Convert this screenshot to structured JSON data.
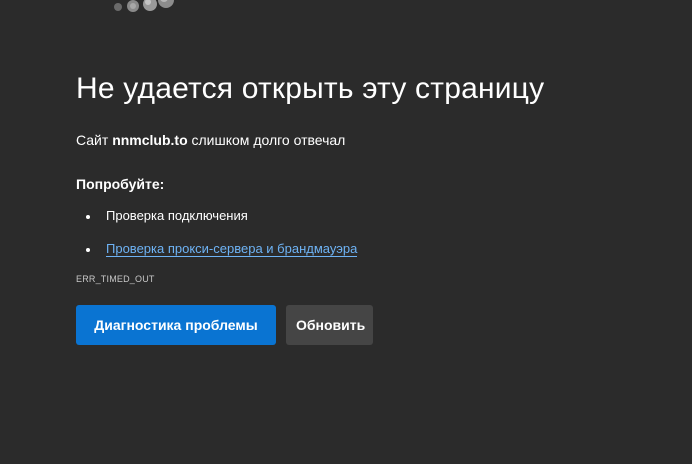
{
  "error_page": {
    "title": "Не удается открыть эту страницу",
    "subtitle_prefix": "Сайт ",
    "host": "nnmclub.to",
    "subtitle_suffix": " слишком долго отвечал",
    "try_heading": "Попробуйте:",
    "suggestions": [
      {
        "label": "Проверка подключения",
        "is_link": false
      },
      {
        "label": "Проверка прокси-сервера и брандмауэра",
        "is_link": true
      }
    ],
    "error_code": "ERR_TIMED_OUT",
    "diagnose_button": "Диагностика проблемы",
    "refresh_button": "Обновить"
  },
  "colors": {
    "background": "#2b2b2b",
    "primary_button": "#0a74d2",
    "secondary_button": "#454545",
    "link": "#6eb3f5"
  },
  "icons": {
    "illustration": "sad-cloud-bubbles-illustration"
  }
}
